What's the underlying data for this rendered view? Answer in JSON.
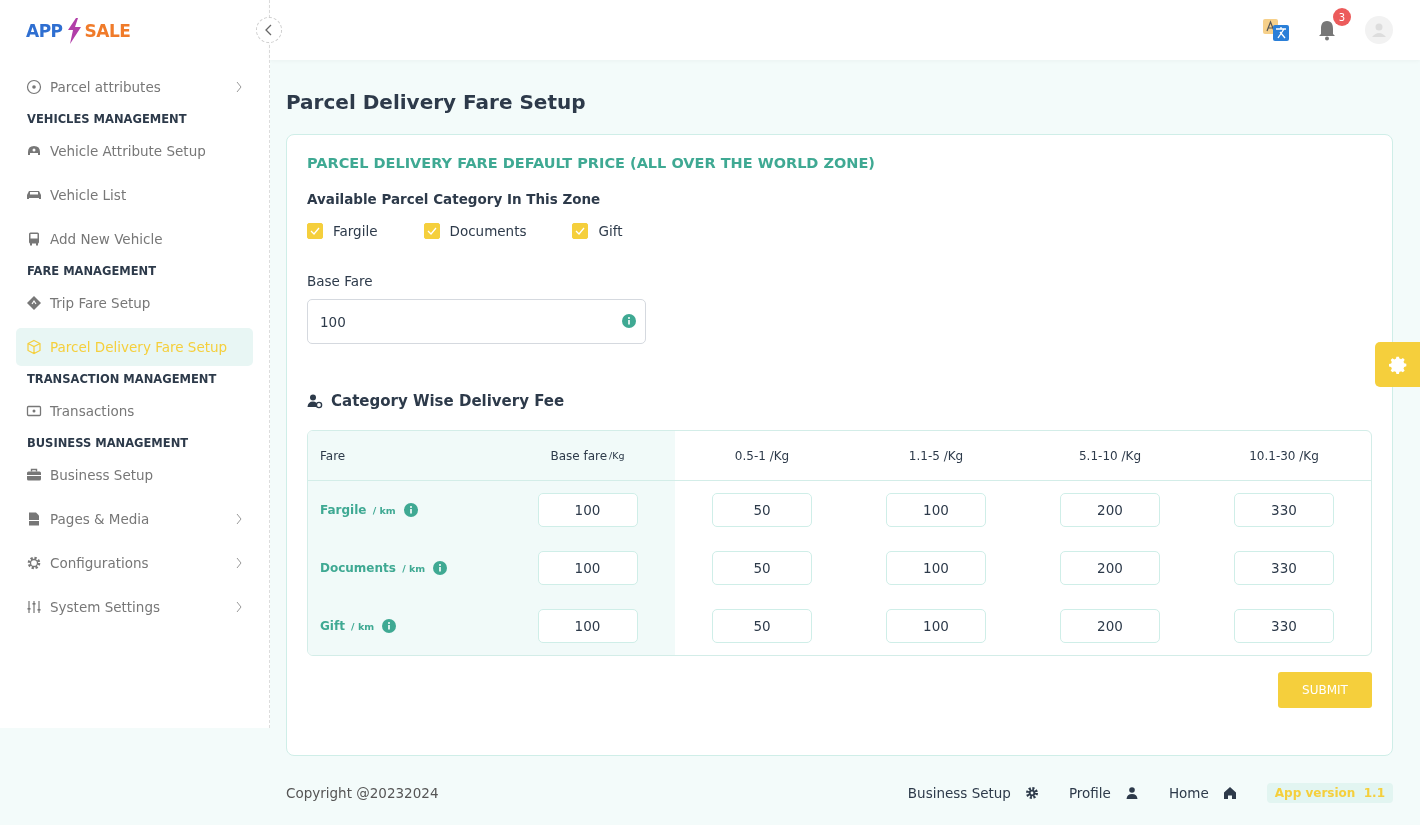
{
  "logo": {
    "left": "APP",
    "right": "SALE"
  },
  "sidebar": {
    "items": [
      {
        "kind": "item",
        "label": "Parcel attributes",
        "chevron": true,
        "selected": false
      },
      {
        "kind": "section",
        "label": "VEHICLES MANAGEMENT"
      },
      {
        "kind": "item",
        "label": "Vehicle Attribute Setup",
        "chevron": false,
        "selected": false
      },
      {
        "kind": "item",
        "label": "Vehicle List",
        "chevron": false,
        "selected": false
      },
      {
        "kind": "item",
        "label": "Add New Vehicle",
        "chevron": false,
        "selected": false
      },
      {
        "kind": "section",
        "label": "FARE MANAGEMENT"
      },
      {
        "kind": "item",
        "label": "Trip Fare Setup",
        "chevron": false,
        "selected": false
      },
      {
        "kind": "item",
        "label": "Parcel Delivery Fare Setup",
        "chevron": false,
        "selected": true
      },
      {
        "kind": "section",
        "label": "TRANSACTION MANAGEMENT"
      },
      {
        "kind": "item",
        "label": "Transactions",
        "chevron": false,
        "selected": false
      },
      {
        "kind": "section",
        "label": "BUSINESS MANAGEMENT"
      },
      {
        "kind": "item",
        "label": "Business Setup",
        "chevron": false,
        "selected": false
      },
      {
        "kind": "item",
        "label": "Pages & Media",
        "chevron": true,
        "selected": false
      },
      {
        "kind": "item",
        "label": "Configurations",
        "chevron": true,
        "selected": false
      },
      {
        "kind": "item",
        "label": "System Settings",
        "chevron": true,
        "selected": false
      }
    ]
  },
  "topbar": {
    "notification_count": "3"
  },
  "page_title": "Parcel Delivery Fare Setup",
  "card": {
    "title": "PARCEL DELIVERY FARE DEFAULT PRICE (ALL OVER THE WORLD ZONE)",
    "category_heading": "Available Parcel Category In This Zone",
    "categories": [
      {
        "label": "Fargile",
        "checked": true
      },
      {
        "label": "Documents",
        "checked": true
      },
      {
        "label": "Gift",
        "checked": true
      }
    ],
    "base_fare": {
      "label": "Base Fare",
      "value": "100"
    },
    "section_title": "Category Wise Delivery Fee",
    "table": {
      "columns": [
        {
          "label": "Fare"
        },
        {
          "label": "Base fare",
          "unit": "/Kg"
        },
        {
          "label": "0.5-1 /Kg"
        },
        {
          "label": "1.1-5 /Kg"
        },
        {
          "label": "5.1-10 /Kg"
        },
        {
          "label": "10.1-30 /Kg"
        }
      ],
      "rows": [
        {
          "label": "Fargile",
          "unit": "/ km",
          "values": [
            "100",
            "50",
            "100",
            "200",
            "330"
          ]
        },
        {
          "label": "Documents",
          "unit": "/ km",
          "values": [
            "100",
            "50",
            "100",
            "200",
            "330"
          ]
        },
        {
          "label": "Gift",
          "unit": "/ km",
          "values": [
            "100",
            "50",
            "100",
            "200",
            "330"
          ]
        }
      ]
    },
    "submit": "SUBMIT"
  },
  "footer": {
    "copyright": "Copyright @20232024",
    "links": [
      {
        "label": "Business Setup"
      },
      {
        "label": "Profile"
      },
      {
        "label": "Home"
      }
    ],
    "version_label": "App version",
    "version": "1.1"
  }
}
